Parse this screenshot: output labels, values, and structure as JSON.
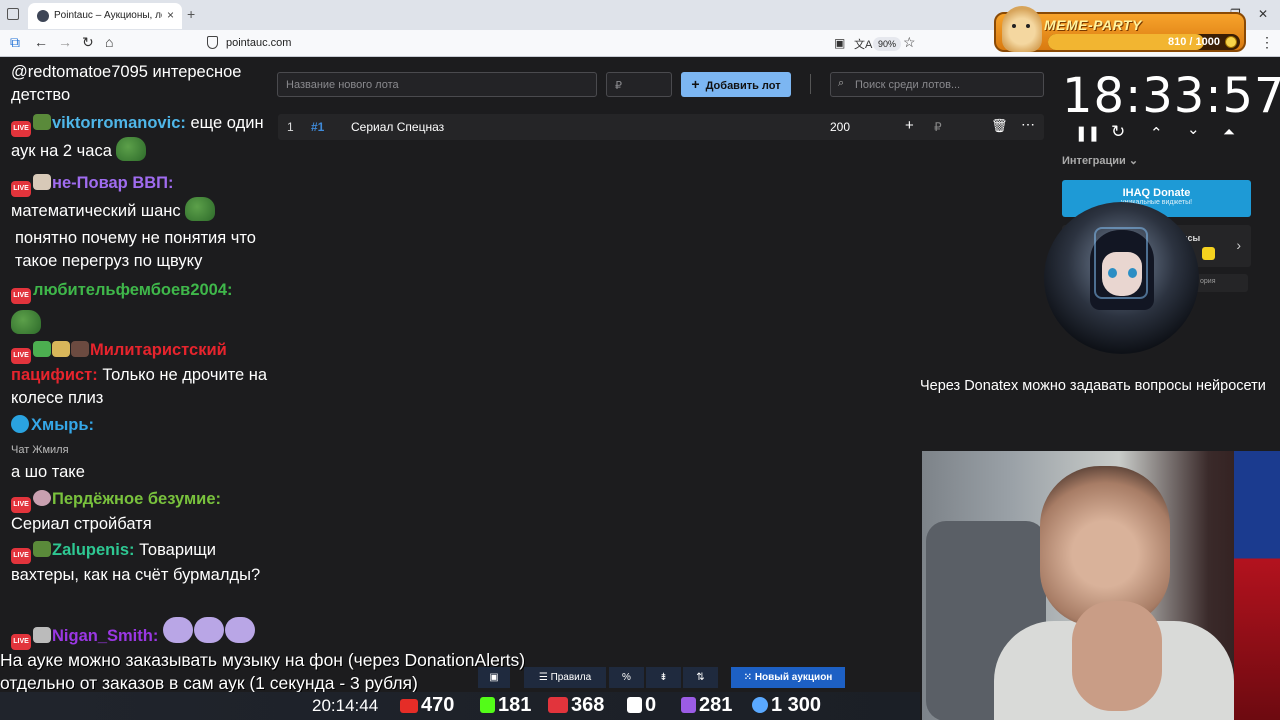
{
  "browser": {
    "tab_title": "Pointauc – Аукционы, лотереи",
    "url": "pointauc.com",
    "zoom": "90%"
  },
  "meme_party": {
    "name": "MEME-PARTY",
    "counter": "810 / 1000",
    "progress": 0.81
  },
  "chat": {
    "messages": [
      {
        "nick": "",
        "text": "@redtomatoe7095 интересное детство"
      },
      {
        "nick": "viktorromanovic:",
        "text": "еще один аук на 2 часа",
        "color": "#4fb6e8"
      },
      {
        "nick": "не-Повар ВВП:",
        "text": "математический шанс",
        "color": "#a06cf0"
      },
      {
        "nick": "",
        "text": "понятно почему не понятия что такое перегруз по щвуку"
      },
      {
        "nick": "любительфембоев2004:",
        "text": "",
        "color": "#3fb74a"
      },
      {
        "nick": "Милитаристский пацифист:",
        "text": "Только не дрочите на колесе плиз",
        "color": "#e6242d"
      },
      {
        "nick": "Хмырь:",
        "sub": "Чат Жмиля",
        "text": "а шо таке",
        "color": "#35a7e8"
      },
      {
        "nick": "Пердёжное безумие:",
        "text": "Сериал стройбатя",
        "color": "#79c23d"
      },
      {
        "nick": "Zalupenis:",
        "text": "Товарищи вахтеры, как на счёт бурмалды?",
        "color": "#2ec792"
      },
      {
        "nick": "Nigan_Smith:",
        "text": "",
        "color": "#9a37e3"
      }
    ]
  },
  "app": {
    "new_lot_placeholder": "Название нового лота",
    "amount_placeholder": "₽",
    "add_lot_label": "Добавить лот",
    "search_placeholder": "Поиск среди лотов...",
    "lots": [
      {
        "index": "1",
        "id": "#1",
        "name": "Сериал Спецназ",
        "amount": "200",
        "currency": "₽"
      }
    ],
    "timer": "18:33:57",
    "integrations_label": "Интеграции",
    "ihaq_title": "IHAQ Donate",
    "ihaq_sub": "уникальные виджеты!",
    "card2_text": "исы",
    "card3_text": "ория",
    "toolbar": {
      "rules": "Правила",
      "new_auction": "Новый аукцион"
    }
  },
  "overlays": {
    "donatex": "Через Donatex можно задавать вопросы нейросети",
    "music_line1": "На ауке можно заказывать музыку на фон (через DonationAlerts)",
    "music_line2": "отдельно от заказов в сам аук (1 секунда - 3 рубля)"
  },
  "status_bar": {
    "time": "20:14:44",
    "youtube": "470",
    "kick": "181",
    "vk": "368",
    "rutube": "0",
    "other": "281",
    "viewers": "1 300"
  }
}
